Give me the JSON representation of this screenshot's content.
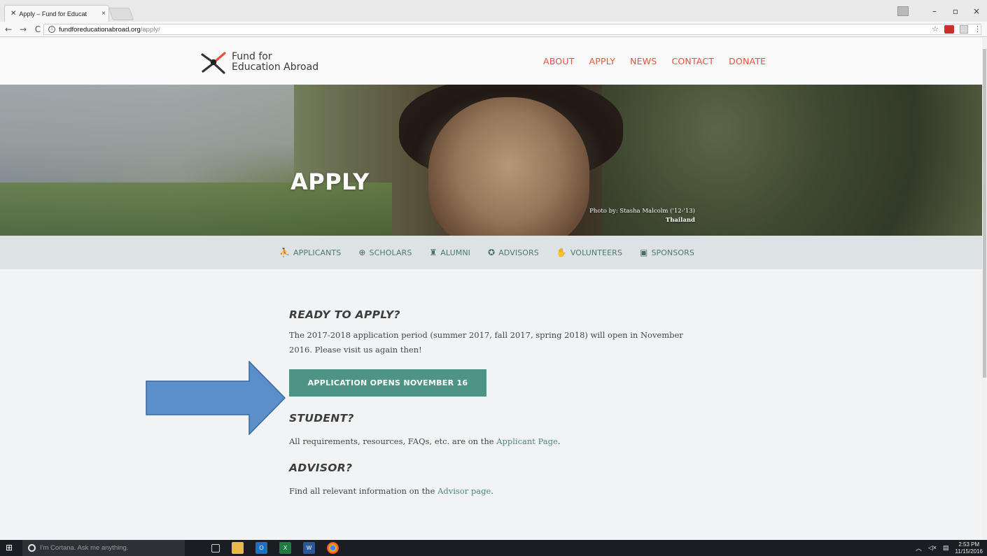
{
  "browser": {
    "tab_title": "Apply – Fund for Educat",
    "tab_close": "×",
    "url_host": "fundforeducationabroad.org",
    "url_path": "/apply/",
    "window_controls": [
      "–",
      "▫",
      "×"
    ],
    "nav": [
      "←",
      "→",
      "C"
    ]
  },
  "site": {
    "logo_line1": "Fund for",
    "logo_line2": "Education Abroad",
    "nav": [
      "ABOUT",
      "APPLY",
      "NEWS",
      "CONTACT",
      "DONATE"
    ],
    "accent_color": "#e5533d",
    "teal_color": "#4e9484"
  },
  "hero": {
    "title": "APPLY",
    "credit_line": "Photo by: Stasha Malcolm ('12-'13)",
    "credit_location": "Thailand"
  },
  "subnav": [
    {
      "label": "APPLICANTS",
      "icon": "people-icon"
    },
    {
      "label": "SCHOLARS",
      "icon": "globe-icon"
    },
    {
      "label": "ALUMNI",
      "icon": "graduate-icon"
    },
    {
      "label": "ADVISORS",
      "icon": "handshake-icon"
    },
    {
      "label": "VOLUNTEERS",
      "icon": "hand-icon"
    },
    {
      "label": "SPONSORS",
      "icon": "gift-icon"
    }
  ],
  "content": {
    "ready_heading": "READY TO APPLY?",
    "ready_text": "The 2017-2018 application period (summer 2017, fall 2017, spring 2018) will open in November 2016. Please visit us again then!",
    "cta_label": "APPLICATION OPENS NOVEMBER 16",
    "student_heading": "STUDENT?",
    "student_text_pre": "All requirements, resources, FAQs, etc. are on the ",
    "student_link": "Applicant Page",
    "student_text_post": ".",
    "advisor_heading": "ADVISOR?",
    "advisor_text_pre": "Find all relevant information on the ",
    "advisor_link": "Advisor page",
    "advisor_text_post": "."
  },
  "taskbar": {
    "cortana_placeholder": "I'm Cortana. Ask me anything.",
    "time": "2:53 PM",
    "date": "11/15/2016"
  }
}
